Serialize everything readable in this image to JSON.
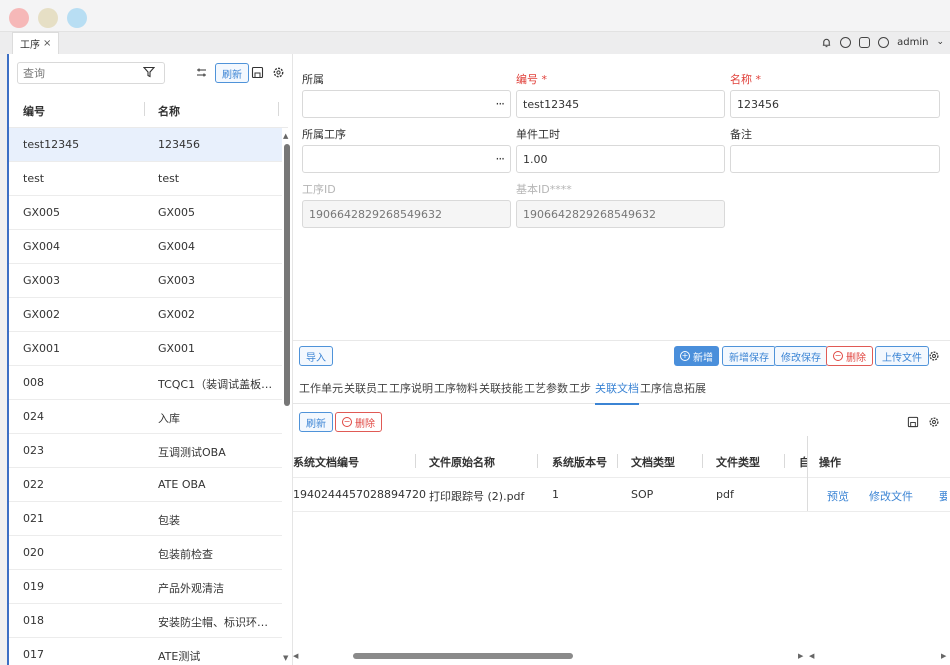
{
  "window": {
    "tab_label": "工序",
    "tab_close": "×",
    "user": "admin"
  },
  "left": {
    "search_placeholder": "查询",
    "refresh_label": "刷新",
    "columns": [
      "编号",
      "名称"
    ],
    "rows": [
      {
        "code": "test12345",
        "name": "123456",
        "selected": true
      },
      {
        "code": "test",
        "name": "test"
      },
      {
        "code": "GX005",
        "name": "GX005"
      },
      {
        "code": "GX004",
        "name": "GX004"
      },
      {
        "code": "GX003",
        "name": "GX003"
      },
      {
        "code": "GX002",
        "name": "GX002"
      },
      {
        "code": "GX001",
        "name": "GX001"
      },
      {
        "code": "008",
        "name": "TCQC1（装调试盖板前..."
      },
      {
        "code": "024",
        "name": "入库"
      },
      {
        "code": "023",
        "name": "互调测试OBA"
      },
      {
        "code": "022",
        "name": "ATE OBA"
      },
      {
        "code": "021",
        "name": "包装"
      },
      {
        "code": "020",
        "name": "包装前检查"
      },
      {
        "code": "019",
        "name": "产品外观清洁"
      },
      {
        "code": "018",
        "name": "安装防尘帽、标识环（..."
      },
      {
        "code": "017",
        "name": "ATE测试"
      }
    ]
  },
  "form": {
    "owner_label": "所属",
    "owner_value": "",
    "code_label": "编号 *",
    "code_value": "test12345",
    "name_label": "名称 *",
    "name_value": "123456",
    "process_label": "所属工序",
    "process_value": "",
    "unit_time_label": "单件工时",
    "unit_time_value": "1.00",
    "remark_label": "备注",
    "remark_value": "",
    "id_label": "工序ID",
    "id_value": "1906642829268549632",
    "base_id_label": "基本ID****",
    "base_id_value": "1906642829268549632"
  },
  "actions": {
    "import": "导入",
    "add": "新增",
    "add_save": "新增保存",
    "edit_save": "修改保存",
    "delete": "删除",
    "upload": "上传文件"
  },
  "subtabs": [
    "工作单元",
    "关联员工",
    "工序说明",
    "工序物料",
    "关联技能",
    "工艺参数",
    "工步",
    "关联文档",
    "工序信息拓展"
  ],
  "subtabs_active": "关联文档",
  "doc_toolbar": {
    "refresh": "刷新",
    "delete": "删除"
  },
  "doc_table": {
    "headers": [
      "系统文档编号",
      "文件原始名称",
      "系统版本号",
      "文档类型",
      "文件类型",
      "自",
      "操作"
    ],
    "row": {
      "doc_no": "1940244457028894720",
      "file_name": "打印跟踪号 (2).pdf",
      "version": "1",
      "doc_type": "SOP",
      "file_type": "pdf",
      "op_preview": "预览",
      "op_edit": "修改文件",
      "op_more": "要"
    }
  }
}
